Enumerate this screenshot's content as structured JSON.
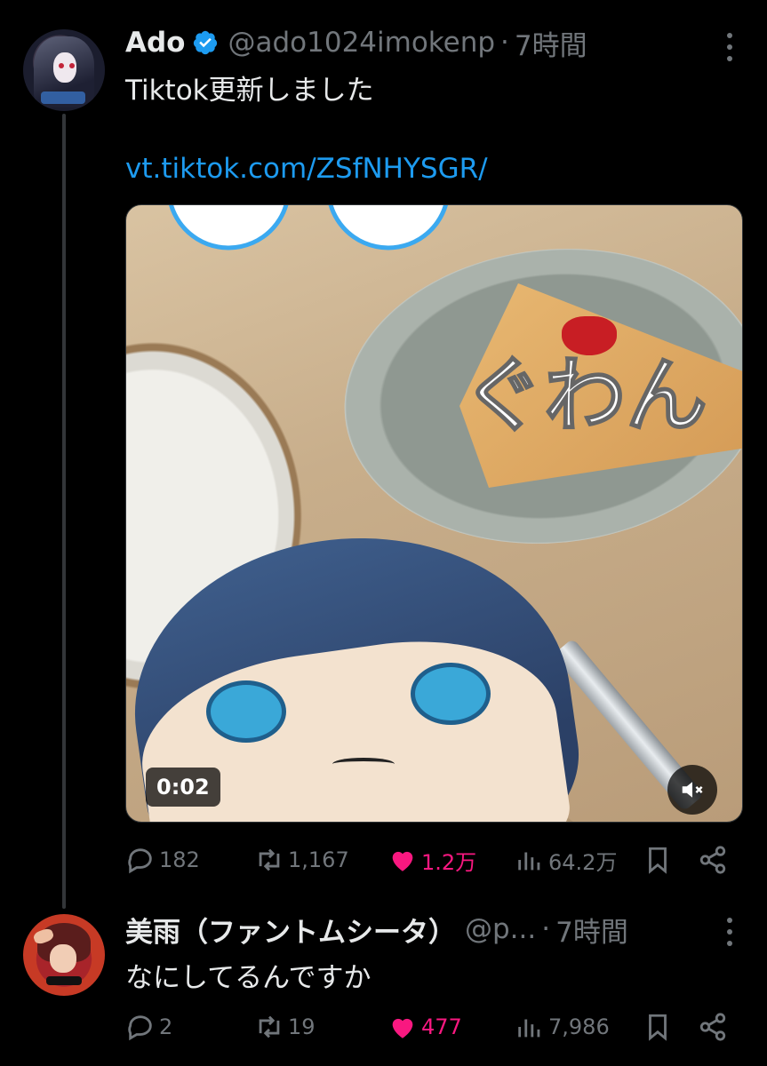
{
  "tweet": {
    "name": "Ado",
    "handle": "@ado1024imokenp",
    "separator": "·",
    "time": "7時間",
    "text": "Tiktok更新しました",
    "link": "vt.tiktok.com/ZSfNHYSGR/",
    "media": {
      "overlay_text": "ぐわん",
      "duration": "0:02",
      "muted": true
    },
    "actions": {
      "replies": "182",
      "retweets": "1,167",
      "likes": "1.2万",
      "views": "64.2万"
    }
  },
  "reply": {
    "name": "美雨（ファントムシータ）",
    "handle": "@p...",
    "separator": "·",
    "time": "7時間",
    "text": "なにしてるんですか",
    "actions": {
      "replies": "2",
      "retweets": "19",
      "likes": "477",
      "views": "7,986"
    }
  },
  "colors": {
    "background": "#000000",
    "link": "#1d9bf0",
    "muted_text": "#71767b",
    "like": "#f91880"
  },
  "icons": [
    "verified-badge-icon",
    "more-icon",
    "reply-icon",
    "retweet-icon",
    "heart-icon",
    "views-icon",
    "bookmark-icon",
    "share-icon",
    "mute-icon"
  ]
}
